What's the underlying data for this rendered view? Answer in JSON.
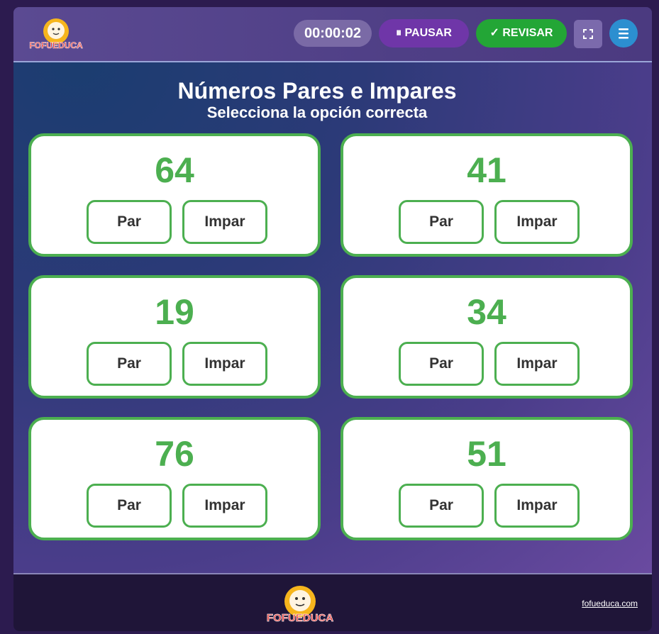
{
  "header": {
    "logo_text": "FOFUEDUCA",
    "timer": "00:00:02",
    "pause_label": "⏸ PAUSAR",
    "review_label": "✓ REVISAR",
    "fullscreen_icon": "fullscreen-icon",
    "menu_icon": "hamburger-menu-icon"
  },
  "main": {
    "title": "Números Pares e Impares",
    "subtitle": "Selecciona la opción correcta",
    "cards": [
      {
        "number": "64",
        "option_par": "Par",
        "option_impar": "Impar"
      },
      {
        "number": "41",
        "option_par": "Par",
        "option_impar": "Impar"
      },
      {
        "number": "19",
        "option_par": "Par",
        "option_impar": "Impar"
      },
      {
        "number": "34",
        "option_par": "Par",
        "option_impar": "Impar"
      },
      {
        "number": "76",
        "option_par": "Par",
        "option_impar": "Impar"
      },
      {
        "number": "51",
        "option_par": "Par",
        "option_impar": "Impar"
      }
    ]
  },
  "footer": {
    "logo_text": "FOFUEDUCA",
    "link": "fofueduca.com"
  },
  "colors": {
    "accent_green": "#4caf50",
    "pause_purple": "#6f36a8",
    "review_green": "#23a636",
    "menu_blue": "#2c8fd0"
  }
}
